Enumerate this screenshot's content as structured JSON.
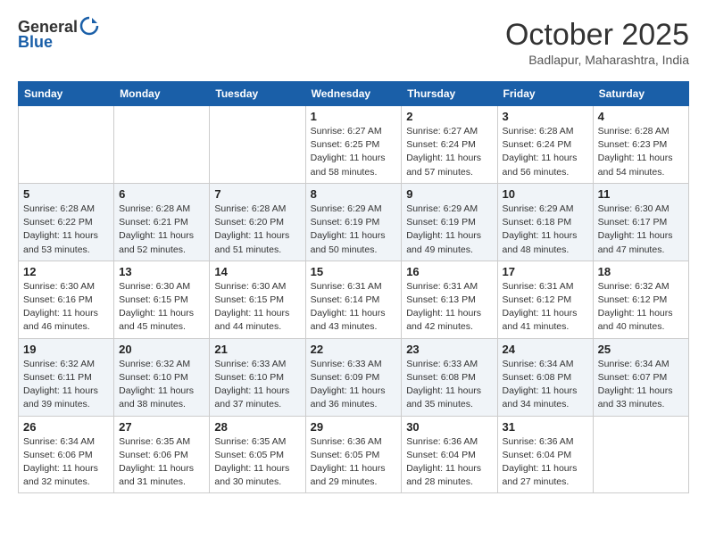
{
  "logo": {
    "text_general": "General",
    "text_blue": "Blue"
  },
  "header": {
    "month": "October 2025",
    "location": "Badlapur, Maharashtra, India"
  },
  "weekdays": [
    "Sunday",
    "Monday",
    "Tuesday",
    "Wednesday",
    "Thursday",
    "Friday",
    "Saturday"
  ],
  "weeks": [
    [
      {
        "day": "",
        "sunrise": "",
        "sunset": "",
        "daylight": ""
      },
      {
        "day": "",
        "sunrise": "",
        "sunset": "",
        "daylight": ""
      },
      {
        "day": "",
        "sunrise": "",
        "sunset": "",
        "daylight": ""
      },
      {
        "day": "1",
        "sunrise": "Sunrise: 6:27 AM",
        "sunset": "Sunset: 6:25 PM",
        "daylight": "Daylight: 11 hours and 58 minutes."
      },
      {
        "day": "2",
        "sunrise": "Sunrise: 6:27 AM",
        "sunset": "Sunset: 6:24 PM",
        "daylight": "Daylight: 11 hours and 57 minutes."
      },
      {
        "day": "3",
        "sunrise": "Sunrise: 6:28 AM",
        "sunset": "Sunset: 6:24 PM",
        "daylight": "Daylight: 11 hours and 56 minutes."
      },
      {
        "day": "4",
        "sunrise": "Sunrise: 6:28 AM",
        "sunset": "Sunset: 6:23 PM",
        "daylight": "Daylight: 11 hours and 54 minutes."
      }
    ],
    [
      {
        "day": "5",
        "sunrise": "Sunrise: 6:28 AM",
        "sunset": "Sunset: 6:22 PM",
        "daylight": "Daylight: 11 hours and 53 minutes."
      },
      {
        "day": "6",
        "sunrise": "Sunrise: 6:28 AM",
        "sunset": "Sunset: 6:21 PM",
        "daylight": "Daylight: 11 hours and 52 minutes."
      },
      {
        "day": "7",
        "sunrise": "Sunrise: 6:28 AM",
        "sunset": "Sunset: 6:20 PM",
        "daylight": "Daylight: 11 hours and 51 minutes."
      },
      {
        "day": "8",
        "sunrise": "Sunrise: 6:29 AM",
        "sunset": "Sunset: 6:19 PM",
        "daylight": "Daylight: 11 hours and 50 minutes."
      },
      {
        "day": "9",
        "sunrise": "Sunrise: 6:29 AM",
        "sunset": "Sunset: 6:19 PM",
        "daylight": "Daylight: 11 hours and 49 minutes."
      },
      {
        "day": "10",
        "sunrise": "Sunrise: 6:29 AM",
        "sunset": "Sunset: 6:18 PM",
        "daylight": "Daylight: 11 hours and 48 minutes."
      },
      {
        "day": "11",
        "sunrise": "Sunrise: 6:30 AM",
        "sunset": "Sunset: 6:17 PM",
        "daylight": "Daylight: 11 hours and 47 minutes."
      }
    ],
    [
      {
        "day": "12",
        "sunrise": "Sunrise: 6:30 AM",
        "sunset": "Sunset: 6:16 PM",
        "daylight": "Daylight: 11 hours and 46 minutes."
      },
      {
        "day": "13",
        "sunrise": "Sunrise: 6:30 AM",
        "sunset": "Sunset: 6:15 PM",
        "daylight": "Daylight: 11 hours and 45 minutes."
      },
      {
        "day": "14",
        "sunrise": "Sunrise: 6:30 AM",
        "sunset": "Sunset: 6:15 PM",
        "daylight": "Daylight: 11 hours and 44 minutes."
      },
      {
        "day": "15",
        "sunrise": "Sunrise: 6:31 AM",
        "sunset": "Sunset: 6:14 PM",
        "daylight": "Daylight: 11 hours and 43 minutes."
      },
      {
        "day": "16",
        "sunrise": "Sunrise: 6:31 AM",
        "sunset": "Sunset: 6:13 PM",
        "daylight": "Daylight: 11 hours and 42 minutes."
      },
      {
        "day": "17",
        "sunrise": "Sunrise: 6:31 AM",
        "sunset": "Sunset: 6:12 PM",
        "daylight": "Daylight: 11 hours and 41 minutes."
      },
      {
        "day": "18",
        "sunrise": "Sunrise: 6:32 AM",
        "sunset": "Sunset: 6:12 PM",
        "daylight": "Daylight: 11 hours and 40 minutes."
      }
    ],
    [
      {
        "day": "19",
        "sunrise": "Sunrise: 6:32 AM",
        "sunset": "Sunset: 6:11 PM",
        "daylight": "Daylight: 11 hours and 39 minutes."
      },
      {
        "day": "20",
        "sunrise": "Sunrise: 6:32 AM",
        "sunset": "Sunset: 6:10 PM",
        "daylight": "Daylight: 11 hours and 38 minutes."
      },
      {
        "day": "21",
        "sunrise": "Sunrise: 6:33 AM",
        "sunset": "Sunset: 6:10 PM",
        "daylight": "Daylight: 11 hours and 37 minutes."
      },
      {
        "day": "22",
        "sunrise": "Sunrise: 6:33 AM",
        "sunset": "Sunset: 6:09 PM",
        "daylight": "Daylight: 11 hours and 36 minutes."
      },
      {
        "day": "23",
        "sunrise": "Sunrise: 6:33 AM",
        "sunset": "Sunset: 6:08 PM",
        "daylight": "Daylight: 11 hours and 35 minutes."
      },
      {
        "day": "24",
        "sunrise": "Sunrise: 6:34 AM",
        "sunset": "Sunset: 6:08 PM",
        "daylight": "Daylight: 11 hours and 34 minutes."
      },
      {
        "day": "25",
        "sunrise": "Sunrise: 6:34 AM",
        "sunset": "Sunset: 6:07 PM",
        "daylight": "Daylight: 11 hours and 33 minutes."
      }
    ],
    [
      {
        "day": "26",
        "sunrise": "Sunrise: 6:34 AM",
        "sunset": "Sunset: 6:06 PM",
        "daylight": "Daylight: 11 hours and 32 minutes."
      },
      {
        "day": "27",
        "sunrise": "Sunrise: 6:35 AM",
        "sunset": "Sunset: 6:06 PM",
        "daylight": "Daylight: 11 hours and 31 minutes."
      },
      {
        "day": "28",
        "sunrise": "Sunrise: 6:35 AM",
        "sunset": "Sunset: 6:05 PM",
        "daylight": "Daylight: 11 hours and 30 minutes."
      },
      {
        "day": "29",
        "sunrise": "Sunrise: 6:36 AM",
        "sunset": "Sunset: 6:05 PM",
        "daylight": "Daylight: 11 hours and 29 minutes."
      },
      {
        "day": "30",
        "sunrise": "Sunrise: 6:36 AM",
        "sunset": "Sunset: 6:04 PM",
        "daylight": "Daylight: 11 hours and 28 minutes."
      },
      {
        "day": "31",
        "sunrise": "Sunrise: 6:36 AM",
        "sunset": "Sunset: 6:04 PM",
        "daylight": "Daylight: 11 hours and 27 minutes."
      },
      {
        "day": "",
        "sunrise": "",
        "sunset": "",
        "daylight": ""
      }
    ]
  ]
}
